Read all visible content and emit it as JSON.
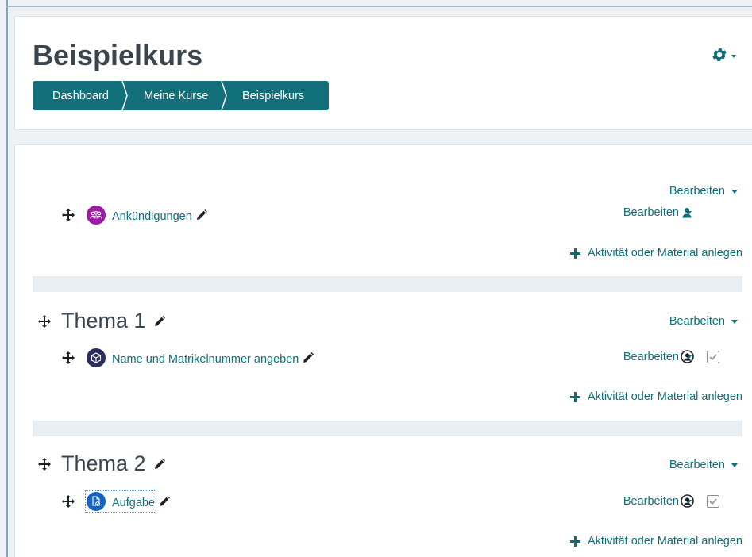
{
  "course": {
    "title": "Beispielkurs"
  },
  "breadcrumb": [
    "Dashboard",
    "Meine Kurse",
    "Beispielkurs"
  ],
  "edit_label": "Bearbeiten",
  "add_label": "Aktivität oder Material anlegen",
  "sections": [
    {
      "title": "",
      "activities": [
        {
          "name": "Ankündigungen",
          "icon": "forum-icon",
          "icon_color": "#9c1aa5"
        }
      ]
    },
    {
      "title": "Thema 1",
      "activities": [
        {
          "name": "Name und Matrikelnummer angeben",
          "icon": "feedback-icon",
          "icon_color": "#2d2e5c"
        }
      ]
    },
    {
      "title": "Thema 2",
      "activities": [
        {
          "name": "Aufgabe",
          "icon": "assignment-icon",
          "icon_color": "#1565c0"
        }
      ]
    }
  ],
  "colors": {
    "accent": "#12707a",
    "link": "#0f6e77",
    "text": "#3a4550"
  }
}
